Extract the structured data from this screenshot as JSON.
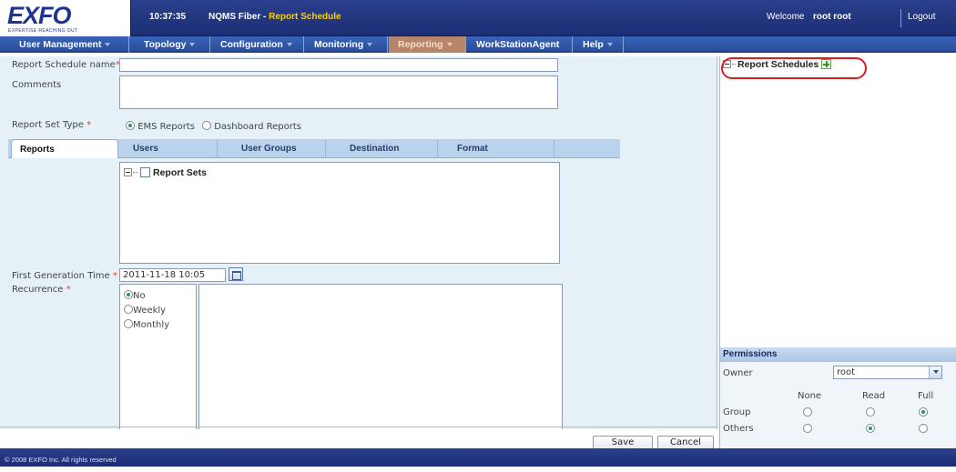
{
  "header": {
    "logo": "EXFO",
    "logo_tagline": "EXPERTISE REACHING OUT",
    "time": "10:37:35",
    "app_name": "NQMS Fiber - ",
    "page_title": "Report Schedule",
    "welcome": "Welcome",
    "user": "root root",
    "logout": "Logout"
  },
  "nav": {
    "items": [
      {
        "label": "User Management"
      },
      {
        "label": "Topology"
      },
      {
        "label": "Configuration"
      },
      {
        "label": "Monitoring"
      },
      {
        "label": "Reporting"
      },
      {
        "label": "WorkStationAgent"
      },
      {
        "label": "Help"
      }
    ]
  },
  "form": {
    "name_label": "Report Schedule name",
    "comments_label": "Comments",
    "report_set_type_label": "Report Set Type",
    "required_mark": "*",
    "report_set_type_options": [
      "EMS Reports",
      "Dashboard Reports"
    ],
    "tabs": [
      "Reports",
      "Users",
      "User Groups",
      "Destination",
      "Format"
    ],
    "tree_root": "Report Sets",
    "first_generation_label": "First Generation Time",
    "first_generation_value": "2011-11-18 10:05",
    "recurrence_label": "Recurrence",
    "recurrence_options": [
      "No",
      "Weekly",
      "Monthly"
    ],
    "save_label": "Save",
    "cancel_label": "Cancel"
  },
  "right_panel": {
    "title": "Report Schedules",
    "permissions": {
      "header": "Permissions",
      "owner_label": "Owner",
      "owner_value": "root",
      "columns": [
        "None",
        "Read",
        "Full"
      ],
      "rows": [
        {
          "label": "Group",
          "selected": "Full"
        },
        {
          "label": "Others",
          "selected": "Read"
        }
      ]
    }
  },
  "footer": {
    "copyright": "© 2008 EXFO Inc. All rights reserved"
  }
}
